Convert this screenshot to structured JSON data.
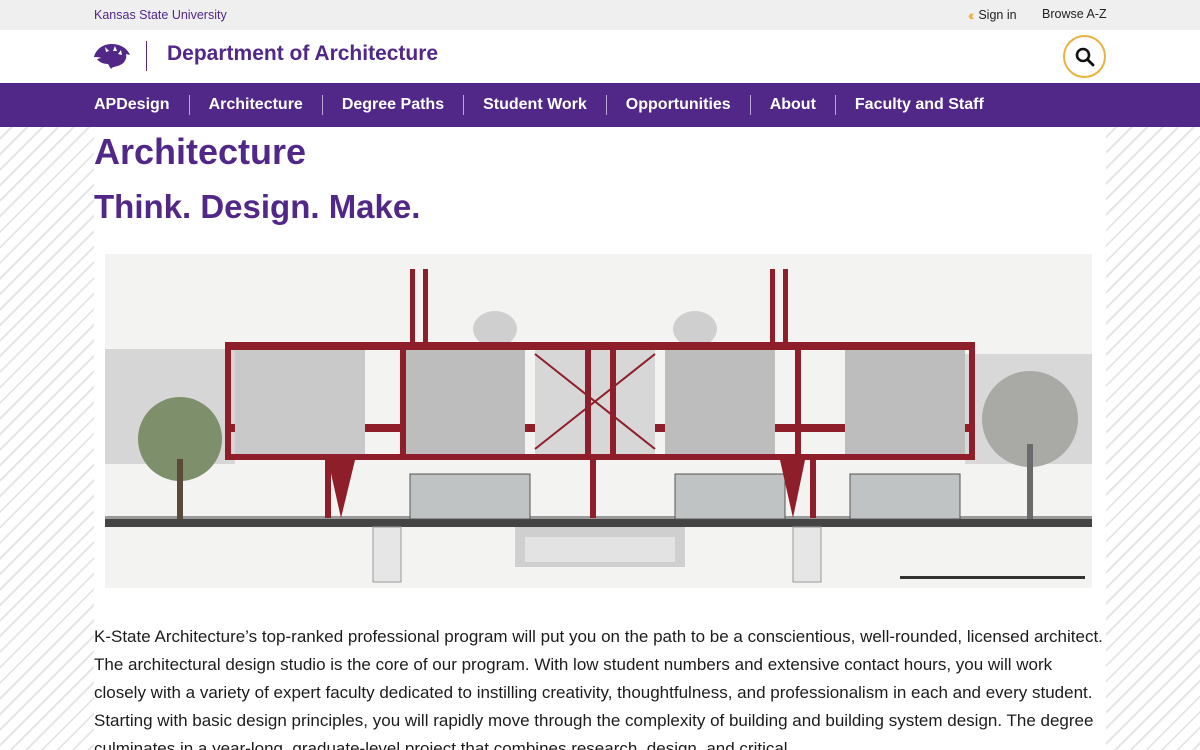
{
  "topbar": {
    "university": "Kansas State University",
    "sign_in": "Sign in",
    "browse": "Browse A-Z"
  },
  "header": {
    "department": "Department of Architecture",
    "logo_icon": "powercat-logo",
    "search_icon": "search-icon"
  },
  "nav": {
    "items": [
      "APDesign",
      "Architecture",
      "Degree Paths",
      "Student Work",
      "Opportunities",
      "About",
      "Faculty and Staff"
    ]
  },
  "main": {
    "title": "Architecture",
    "subtitle": "Think. Design. Make.",
    "paragraph": "K-State Architecture’s top-ranked professional program will put you on the path to be a conscientious, well-rounded, licensed architect. The architectural design studio is the core of our program. With low student numbers and extensive contact hours, you will work closely with a variety of expert faculty dedicated to instilling creativity, thoughtfulness, and professionalism in each and every student. Starting with basic design principles, you will rapidly move through the complexity of building and building system design. The degree culminates in a year-long, graduate-level project that combines research, design, and critical"
  },
  "colors": {
    "purple": "#512888",
    "gold": "#e9b23c",
    "topbar_bg": "#efefef"
  }
}
